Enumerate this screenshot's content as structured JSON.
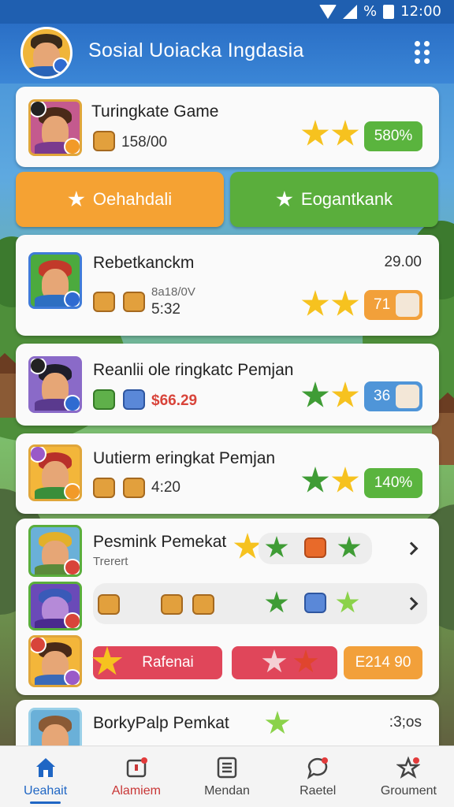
{
  "status_bar": {
    "battery_percent": "%",
    "time": "12:00"
  },
  "header": {
    "title": "Sosial Uoiacka Ingdasia"
  },
  "top_card": {
    "title": "Turingkate Game",
    "points": "158/00",
    "percent": "580%"
  },
  "actions": {
    "left_label": "Oehahdali",
    "right_label": "Eogantkank"
  },
  "cards": [
    {
      "title": "Rebetkanckm",
      "sub_top": "8a18/0V",
      "sub_main": "5:32",
      "right_value": "29.00",
      "pill": "71"
    },
    {
      "title": "Reanlii ole ringkatc Pemjan",
      "sub_main": "$66.29",
      "pill": "36"
    },
    {
      "title": "Uutierm eringkat Pemjan",
      "sub_main": "4:20",
      "pill": "140%"
    }
  ],
  "group_card": {
    "title": "Pesmink Pemekat",
    "subtitle": "Trerert",
    "button_left": "Rafenai",
    "button_right": "E214 90"
  },
  "last_card": {
    "title": "BorkyPalp Pemkat",
    "right_value": ":3;os"
  },
  "nav": [
    {
      "label": "Ueahait",
      "icon": "home-icon"
    },
    {
      "label": "Alamiem",
      "icon": "alert-icon"
    },
    {
      "label": "Mendan",
      "icon": "list-icon"
    },
    {
      "label": "Raetel",
      "icon": "chat-icon"
    },
    {
      "label": "Groument",
      "icon": "group-icon"
    }
  ],
  "colors": {
    "primary": "#2a6fc6",
    "green": "#5ab43e",
    "orange": "#f2a03a",
    "red": "#e0465a"
  }
}
